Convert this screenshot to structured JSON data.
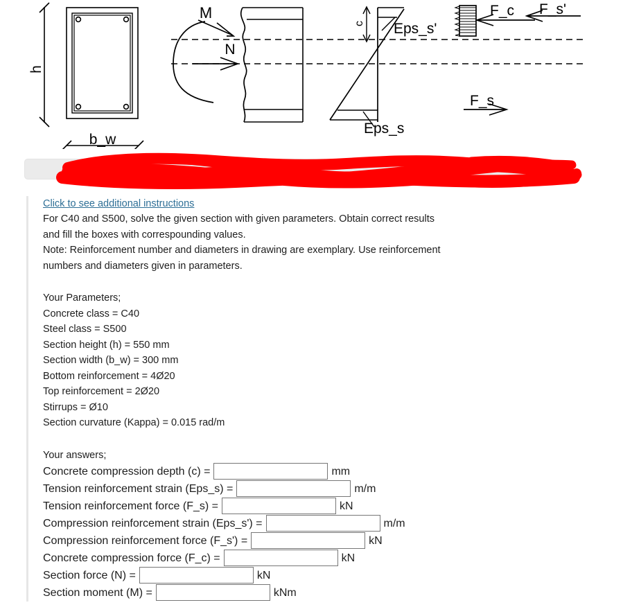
{
  "colors": {
    "link": "#2e6f96",
    "redaction": "#ff0000",
    "toolbar_bg": "#ebebeb",
    "input_border": "#767676",
    "ink": "#000000"
  },
  "diagram": {
    "title": "reinforced-concrete-section-strain-stress-diagram",
    "labels": {
      "height": "h",
      "width": "b_w",
      "moment": "M",
      "normal_force": "N",
      "compression_depth": "c",
      "strain_top": "Eps_s'",
      "strain_bottom": "Eps_s",
      "force_concrete": "F_c",
      "force_comp_steel": "F_s'",
      "force_tension_steel": "F_s"
    }
  },
  "toolbar": {
    "redacted": true,
    "label": ""
  },
  "instructions": {
    "link_label": "Click to see additional instructions",
    "lines": [
      "For C40 and S500, solve the given section with given parameters. Obtain correct results",
      "and fill the boxes with correspounding values.",
      "Note: Reinforcement number and diameters in drawing are exemplary. Use reinforcement",
      "numbers and diameters given in parameters."
    ]
  },
  "parameters": {
    "heading": "Your Parameters;",
    "lines": [
      "Concrete class = C40",
      "Steel class = S500",
      "Section height (h) = 550 mm",
      "Section width (b_w) = 300 mm",
      "Bottom reinforcement = 4Ø20",
      "Top reinforcement = 2Ø20",
      "Stirrups = Ø10",
      "Section curvature (Kappa) = 0.015 rad/m"
    ]
  },
  "answers": {
    "heading": "Your answers;",
    "rows": [
      {
        "label": "Concrete compression depth (c) =",
        "value": "",
        "placeholder": "",
        "unit": "mm"
      },
      {
        "label": "Tension reinforcement strain (Eps_s) =",
        "value": "",
        "placeholder": "",
        "unit": "m/m"
      },
      {
        "label": "Tension reinforcement force (F_s) =",
        "value": "",
        "placeholder": "",
        "unit": "kN"
      },
      {
        "label": "Compression reinforcement strain (Eps_s') =",
        "value": "",
        "placeholder": "",
        "unit": "m/m"
      },
      {
        "label": "Compression reinforcement force (F_s') =",
        "value": "",
        "placeholder": "",
        "unit": "kN"
      },
      {
        "label": "Concrete compression force (F_c) =",
        "value": "",
        "placeholder": "",
        "unit": "kN"
      },
      {
        "label": "Section force (N) =",
        "value": "",
        "placeholder": "",
        "unit": "kN"
      },
      {
        "label": "Section moment (M) =",
        "value": "",
        "placeholder": "",
        "unit": "kNm"
      }
    ]
  }
}
